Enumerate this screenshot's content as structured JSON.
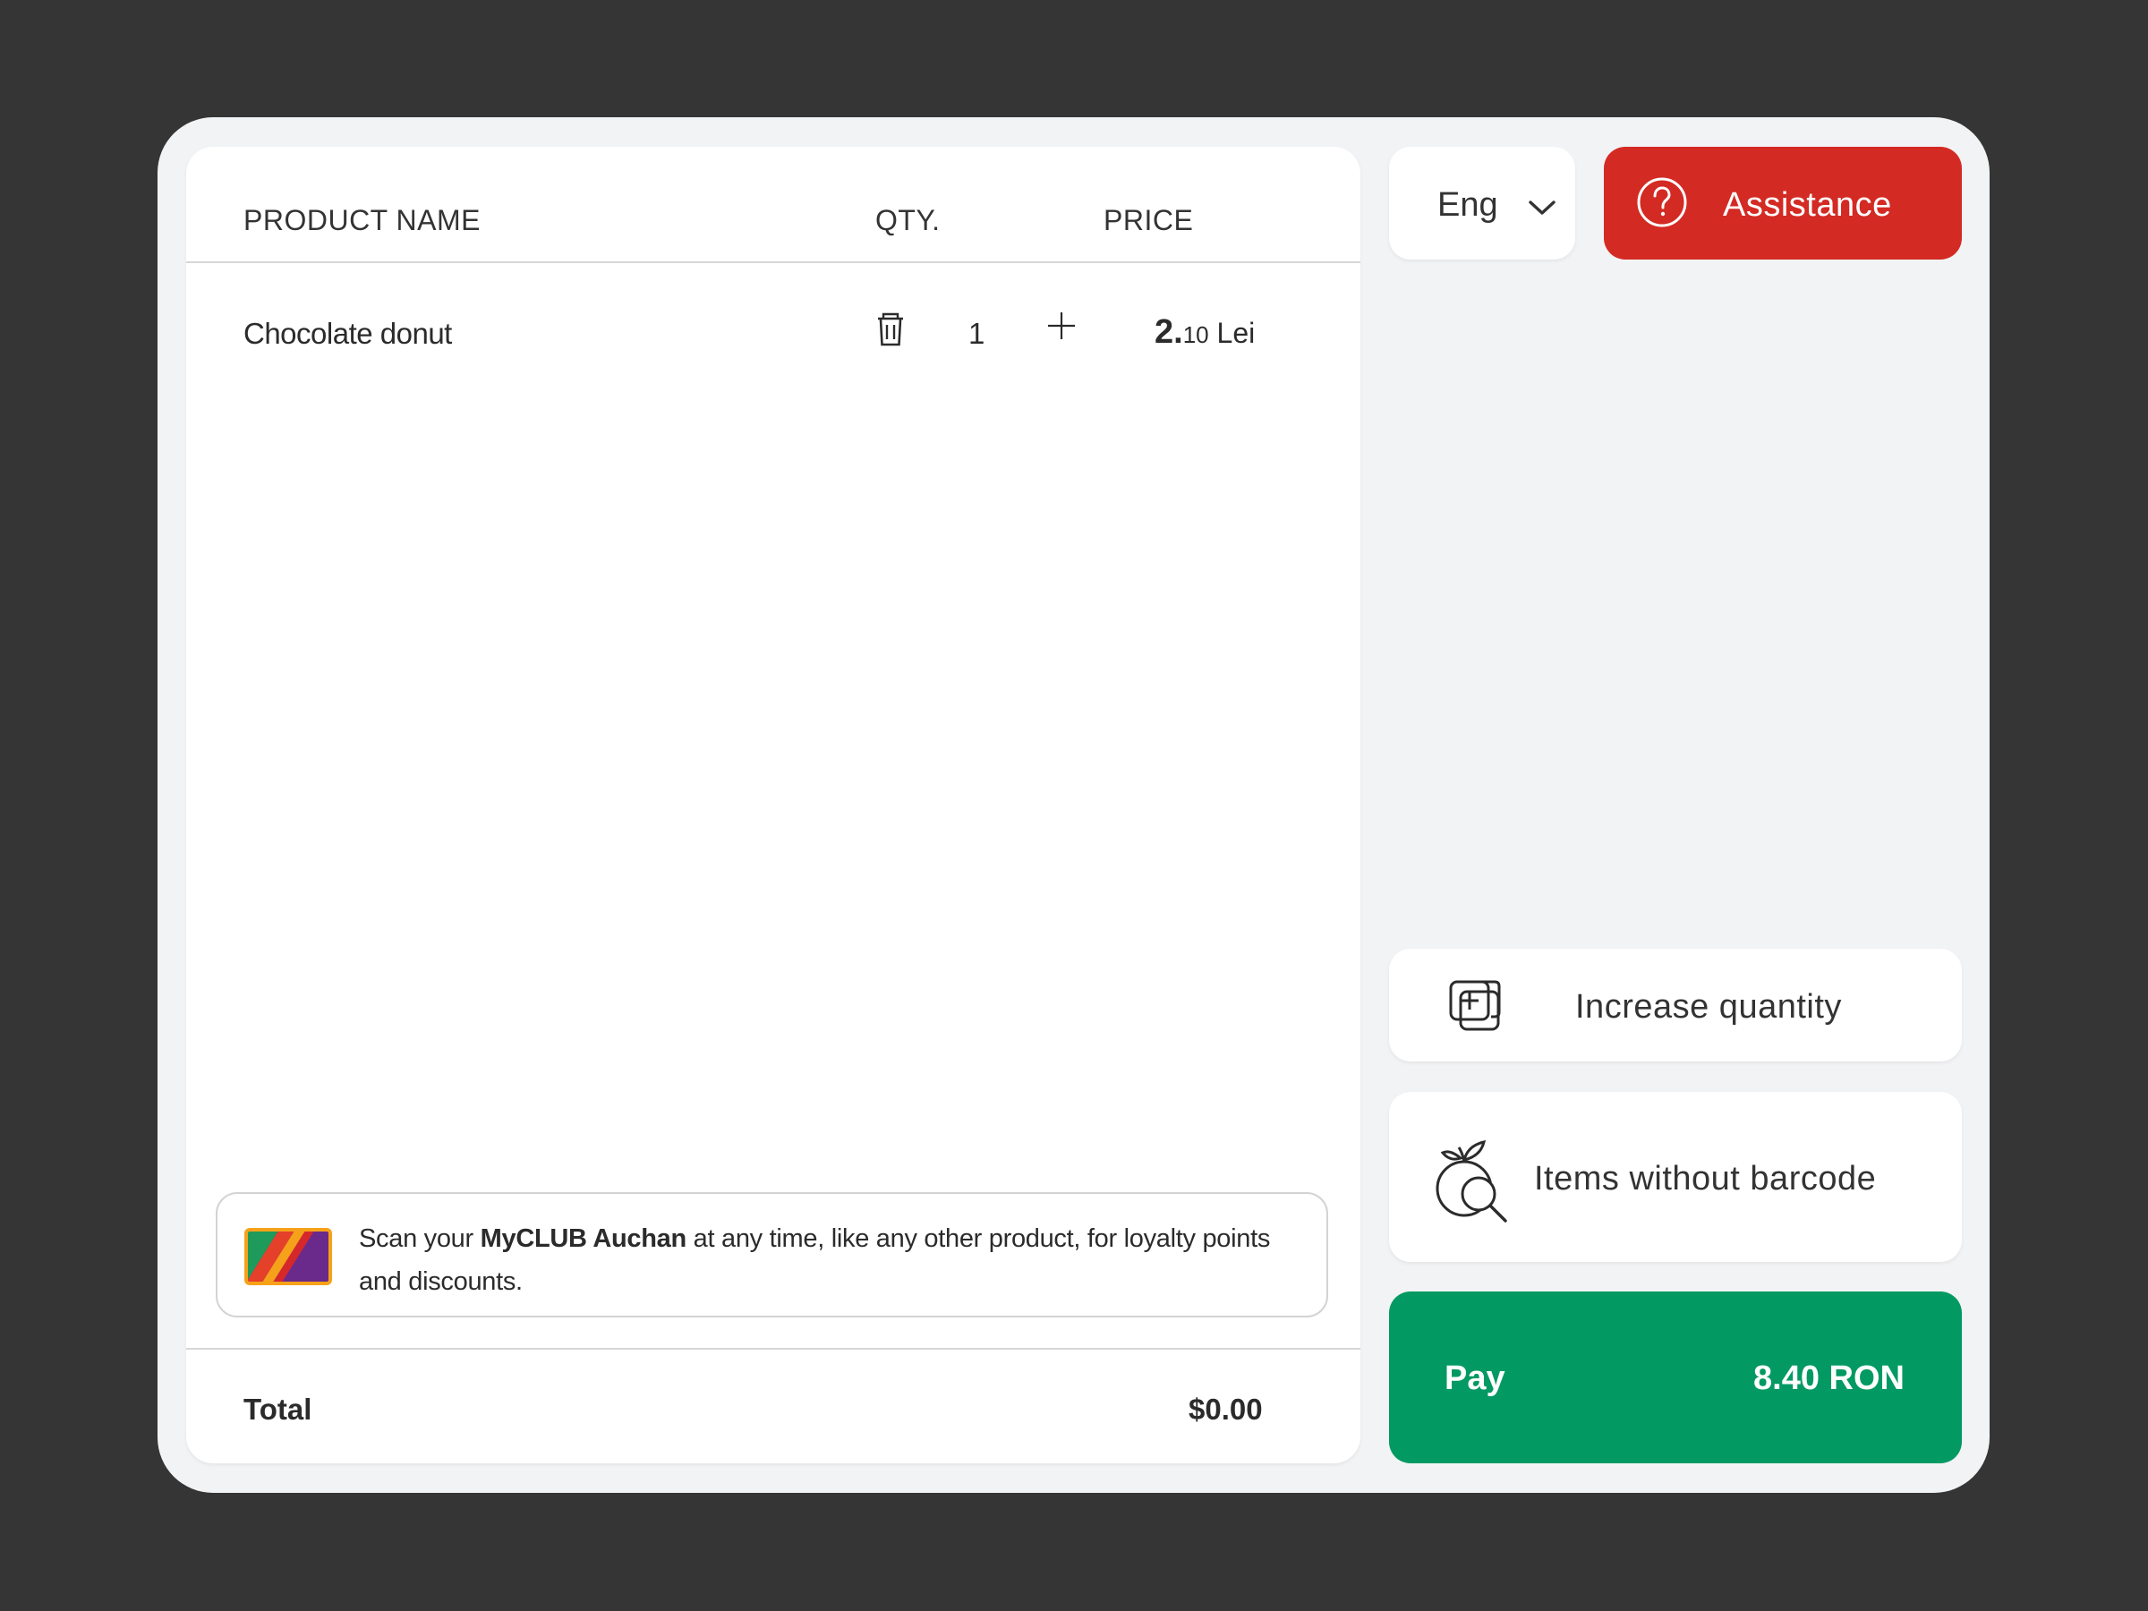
{
  "cart": {
    "headers": {
      "name": "PRODUCT NAME",
      "qty": "QTY.",
      "price": "PRICE"
    },
    "items": [
      {
        "name": "Chocolate donut",
        "qty": "1",
        "price_int": "2.",
        "price_dec": "10",
        "price_unit": " Lei"
      }
    ],
    "loyalty": {
      "prefix": "Scan your ",
      "brand": "MyCLUB Auchan",
      "suffix": " at any time, like any other product, for loyalty points and discounts."
    },
    "total": {
      "label": "Total",
      "value": "$0.00"
    }
  },
  "language": {
    "label": "Eng"
  },
  "assistance": {
    "label": "Assistance"
  },
  "actions": {
    "increase_quantity": "Increase quantity",
    "items_without_barcode": "Items without barcode"
  },
  "pay": {
    "label": "Pay",
    "amount": "8.40 RON"
  },
  "colors": {
    "assistance": "#d32a23",
    "pay": "#029a62",
    "background": "#353535",
    "panel": "#f2f3f5"
  },
  "icons": [
    "trash-icon",
    "plus-icon",
    "chevron-down-icon",
    "question-circle-icon",
    "add-copy-icon",
    "fruit-search-icon",
    "loyalty-card-icon"
  ]
}
